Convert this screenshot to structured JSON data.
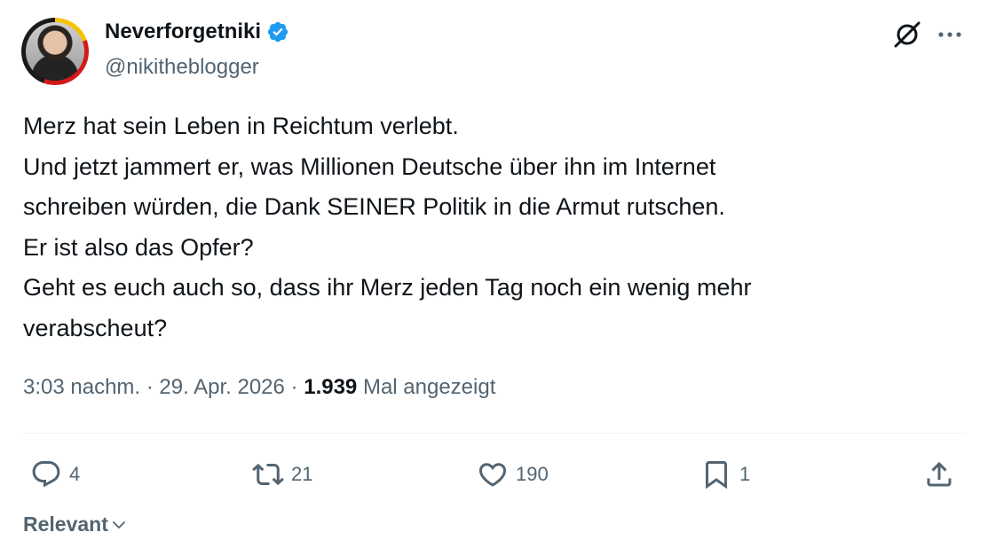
{
  "author": {
    "display_name": "Neverforgetniki",
    "handle": "@nikitheblogger",
    "verified": true,
    "verified_color": "#1d9bf0"
  },
  "header_actions": {
    "grok_icon": "grok-icon",
    "more_icon": "more-icon"
  },
  "tweet": {
    "lines": [
      "Merz hat sein Leben in Reichtum verlebt.",
      "Und jetzt jammert er, was Millionen Deutsche über ihn im Internet",
      "schreiben würden, die Dank SEINER Politik in die Armut rutschen.",
      "Er ist also das Opfer?",
      "Geht es euch auch so, dass ihr Merz jeden Tag noch ein wenig mehr",
      "verabscheut?"
    ]
  },
  "meta": {
    "time": "3:03 nachm.",
    "separator": " · ",
    "date": "29. Apr. 2026",
    "views_count": "1.939",
    "views_label": "Mal angezeigt"
  },
  "actions": {
    "replies": "4",
    "reposts": "21",
    "likes": "190",
    "bookmarks": "1"
  },
  "sort": {
    "label": "Relevant"
  },
  "colors": {
    "text": "#0f1419",
    "secondary": "#536471",
    "divider": "#eff3f4"
  }
}
